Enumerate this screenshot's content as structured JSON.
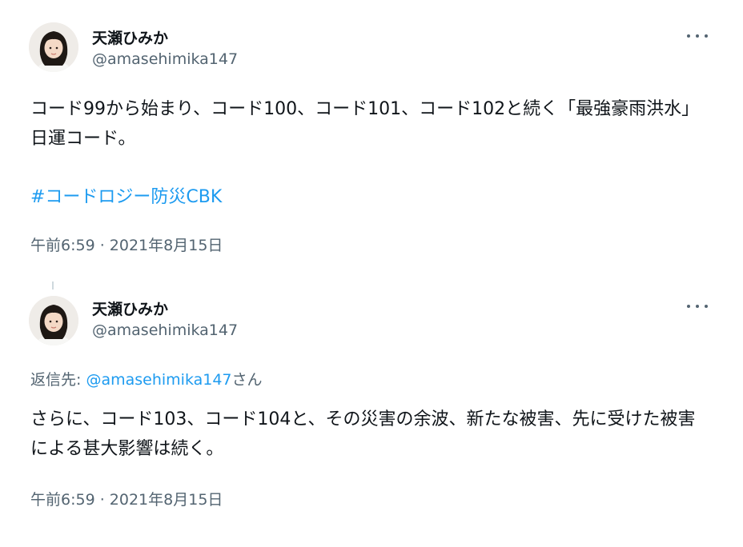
{
  "tweets": [
    {
      "author_name": "天瀬ひみか",
      "author_handle": "@amasehimika147",
      "text": "コード99から始まり、コード100、コード101、コード102と続く「最強豪雨洪水」日運コード。",
      "hashtag": "#コードロジー防災CBK",
      "timestamp": "午前6:59 · 2021年8月15日"
    },
    {
      "author_name": "天瀬ひみか",
      "author_handle": "@amasehimika147",
      "reply_prefix": "返信先: ",
      "reply_mention": "@amasehimika147",
      "reply_suffix": "さん",
      "text": "さらに、コード103、コード104と、その災害の余波、新たな被害、先に受けた被害による甚大影響は続く。",
      "timestamp": "午前6:59 · 2021年8月15日"
    }
  ],
  "icons": {
    "more": "more-horizontal-icon",
    "avatar": "profile-avatar-image"
  },
  "colors": {
    "text_primary": "#0f1419",
    "text_secondary": "#536471",
    "link": "#1d9bf0",
    "thread_line": "#cfd9de"
  }
}
